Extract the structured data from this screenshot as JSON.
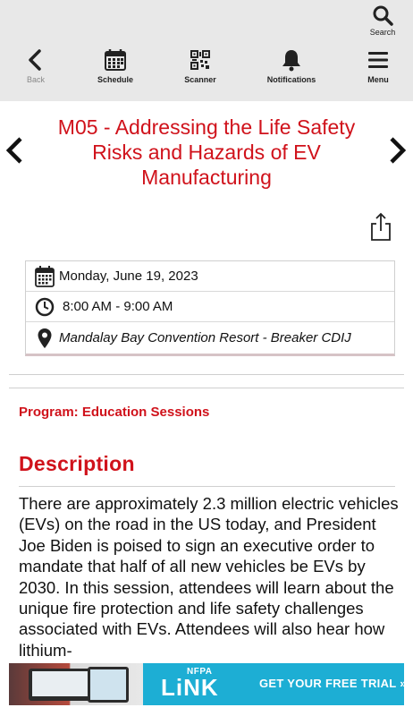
{
  "toolbar": {
    "search_label": "Search",
    "nav": [
      {
        "label": "Back",
        "icon": "chevron-left-icon"
      },
      {
        "label": "Schedule",
        "icon": "calendar-icon"
      },
      {
        "label": "Scanner",
        "icon": "qr-code-icon"
      },
      {
        "label": "Notifications",
        "icon": "bell-icon"
      },
      {
        "label": "Menu",
        "icon": "hamburger-menu-icon"
      }
    ]
  },
  "session": {
    "title": "M05 - Addressing the Life Safety Risks and Hazards of EV Manufacturing",
    "date": "Monday, June 19, 2023",
    "time": "8:00 AM - 9:00 AM",
    "location": "Mandalay Bay Convention Resort - Breaker CDIJ",
    "program": "Program: Education Sessions",
    "description_heading": "Description",
    "description": "There are approximately 2.3 million electric vehicles (EVs) on the road in the US today, and President Joe Biden is poised to sign an executive order to mandate that half of all new vehicles be EVs by 2030. In this session, attendees will learn about the unique fire protection and life safety challenges associated with EVs. Attendees will also hear how lithium-"
  },
  "ad": {
    "brand_top": "NFPA",
    "brand": "LiNK",
    "cta": "GET YOUR FREE TRIAL »"
  },
  "colors": {
    "accent": "#d0121b",
    "toolbar_bg": "#e8e8e8",
    "ad_bg": "#1daed4"
  }
}
